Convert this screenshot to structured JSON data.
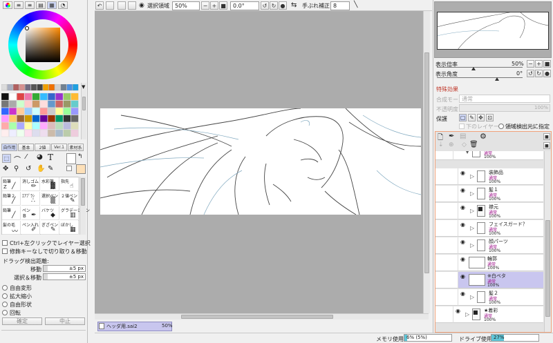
{
  "toolbar": {
    "selection_label": "選択領域",
    "zoom_value": "50%",
    "angle_value": "0.0°",
    "stabilizer_label": "手ぶれ補正",
    "stabilizer_value": "8"
  },
  "navigator": {
    "zoom_label": "表示倍率",
    "zoom_value": "50%",
    "angle_label": "表示角度",
    "angle_value": "0°"
  },
  "effects": {
    "section_label": "特殊効果",
    "blend_label": "合成モード",
    "blend_value": "通常",
    "opacity_label": "不透明度",
    "opacity_value": "100%",
    "protect_label": "保護",
    "clip_label": "下のレイヤーでクリッピング",
    "detect_label": "領域検出元に指定"
  },
  "tool_tabs": [
    "自作用",
    "基本",
    "2値",
    "Ver.1",
    "素材系"
  ],
  "tools": [
    {
      "name": "鉛筆",
      "size": "Z"
    },
    {
      "name": "消しゴム",
      "size": ""
    },
    {
      "name": "水彩筆",
      "size": ""
    },
    {
      "name": "指先",
      "size": ""
    },
    {
      "name": "鉛筆２",
      "size": ""
    },
    {
      "name": "ｴｱﾌﾞﾗｼ",
      "size": ""
    },
    {
      "name": "選択ペン",
      "size": ""
    },
    {
      "name": "２値ペン",
      "size": ""
    },
    {
      "name": "鉛筆",
      "size": ""
    },
    {
      "name": "ペン",
      "size": "B"
    },
    {
      "name": "バケツ",
      "size": ""
    },
    {
      "name": "グラデーション",
      "size": ""
    },
    {
      "name": "髪の毛",
      "size": ""
    },
    {
      "name": "ペン入れ",
      "size": ""
    },
    {
      "name": "ぎざペン",
      "size": ""
    },
    {
      "name": "ぼかし",
      "size": ""
    }
  ],
  "options": {
    "ctrl_click": "Ctrl+左クリックでレイヤー選択",
    "modifier": "修飾キーなしで切り取り＆移動",
    "drag_label": "ドラッグ検出距離:",
    "move_label": "移動",
    "move_value": "±5 px",
    "select_move_label": "選択＆移動",
    "select_move_value": "±5 px",
    "radio_free": "自由変形",
    "radio_scale": "拡大縮小",
    "radio_freeshape": "自由形状",
    "radio_rotate": "回転",
    "confirm": "確定",
    "cancel": "中止"
  },
  "document_tab": {
    "name": "ヘッダ用.sai2",
    "zoom": "50%"
  },
  "status": {
    "memory_label": "メモリ使用量",
    "memory_value": "6% (5%)",
    "drive_label": "ドライブ使用量",
    "drive_value": "27%"
  },
  "layers": [
    {
      "name": "",
      "mode": "通常",
      "opacity": "100%"
    },
    {
      "name": "装飾品",
      "mode": "通常",
      "opacity": "100%"
    },
    {
      "name": "髪１",
      "mode": "通常",
      "opacity": "100%"
    },
    {
      "name": "襟元",
      "mode": "通常",
      "opacity": "100%"
    },
    {
      "name": "フェイスガード？",
      "mode": "通常",
      "opacity": "100%"
    },
    {
      "name": "顔パーツ",
      "mode": "通常",
      "opacity": "100%"
    },
    {
      "name": "輪郭",
      "mode": "通常",
      "opacity": "100%"
    },
    {
      "name": "※白ベタ",
      "mode": "通常",
      "opacity": "100%"
    },
    {
      "name": "髪２",
      "mode": "通常",
      "opacity": "100%"
    },
    {
      "name": "★着彩",
      "mode": "通常",
      "opacity": "100%"
    }
  ]
}
